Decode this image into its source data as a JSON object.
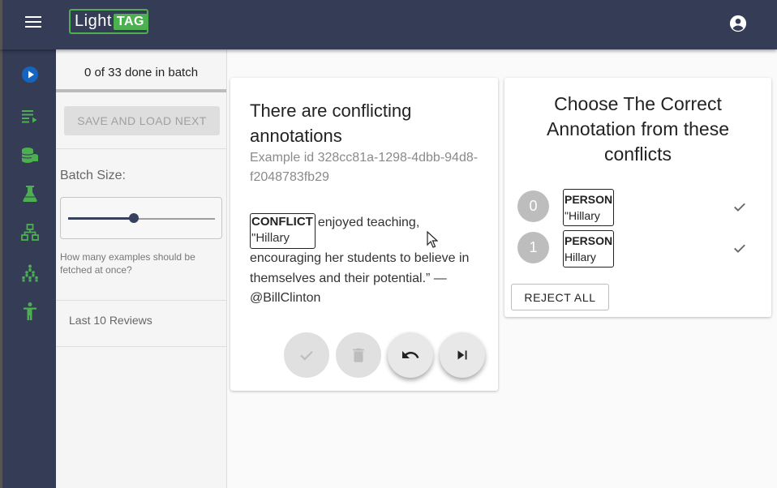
{
  "header": {
    "logo_light": "Light",
    "logo_tag": "TAG",
    "menu_icon": "hamburger-menu-icon",
    "account_icon": "account-circle-icon"
  },
  "rail": {
    "items": [
      {
        "icon": "play-circle-icon",
        "color": "#1565c0"
      },
      {
        "icon": "playlist-icon",
        "color": "#4caf50"
      },
      {
        "icon": "database-icon",
        "color": "#4caf50"
      },
      {
        "icon": "flask-icon",
        "color": "#4caf50"
      },
      {
        "icon": "hierarchy-icon",
        "color": "#4caf50"
      },
      {
        "icon": "people-pyramid-icon",
        "color": "#4caf50"
      },
      {
        "icon": "person-icon",
        "color": "#4caf50"
      }
    ]
  },
  "batch": {
    "status": "0 of 33 done in batch",
    "save_label": "SAVE AND LOAD NEXT",
    "batch_size_label": "Batch Size:",
    "batch_size_fraction": 0.45,
    "help": "How many examples should be fetched at once?",
    "reviews_label": "Last 10 Reviews"
  },
  "example": {
    "title": "There are conflicting annotations",
    "id_line": "Example id 328cc81a-1298-4dbb-94d8-f2048783fb29",
    "annotation_tag": "CONFLICT",
    "annotation_text": "\"Hillary",
    "text_rest": "enjoyed teaching, encouraging her students to believe in themselves and their potential.” — @BillClinton",
    "actions": [
      {
        "icon": "check-icon",
        "enabled": false
      },
      {
        "icon": "trash-icon",
        "enabled": false
      },
      {
        "icon": "undo-icon",
        "enabled": true
      },
      {
        "icon": "skip-next-icon",
        "enabled": true
      }
    ]
  },
  "conflicts": {
    "title": "Choose The Correct Annotation from these conflicts",
    "options": [
      {
        "number": "0",
        "tag": "PERSON",
        "text": "\"Hillary"
      },
      {
        "number": "1",
        "tag": "PERSON",
        "text": "Hillary"
      }
    ],
    "reject_label": "REJECT ALL"
  },
  "colors": {
    "nav_bg": "#353c56",
    "accent_green": "#4caf50",
    "slider": "#37415e"
  }
}
